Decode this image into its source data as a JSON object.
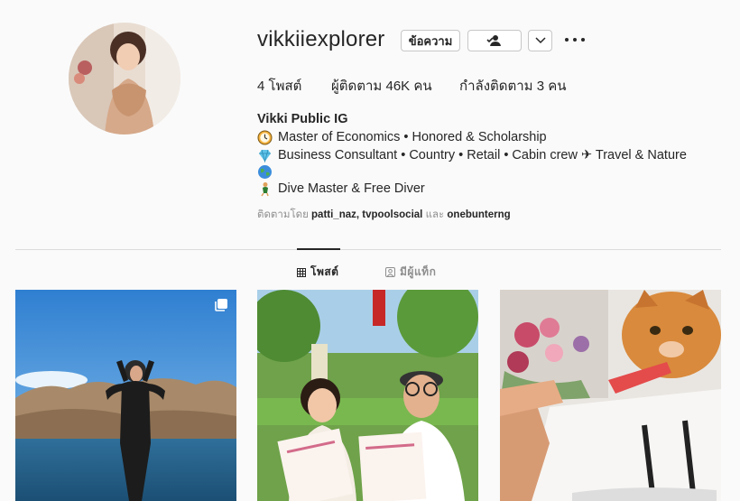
{
  "profile": {
    "username": "vikkiiexplorer",
    "message_button": "ข้อความ",
    "stats": {
      "posts": "4 โพสต์",
      "followers": "ผู้ติดตาม 46K คน",
      "following": "กำลังติดตาม 3 คน"
    },
    "full_name": "Vikki Public IG",
    "bio": [
      {
        "icon": "clock-emoji",
        "text": "Master of Economics • Honored & Scholarship"
      },
      {
        "icon": "gem-emoji",
        "text": "Business Consultant • Country • Retail • Cabin crew ✈ Travel & Nature"
      },
      {
        "icon": "globe-emoji",
        "text": ""
      },
      {
        "icon": "diver-emoji",
        "text": "Dive Master & Free Diver"
      }
    ],
    "followed_by": {
      "prefix": "ติดตามโดย",
      "names": "patti_naz, tvpoolsocial",
      "and": "และ",
      "last": "onebunterng"
    }
  },
  "tabs": {
    "posts": "โพสต์",
    "tagged": "มีผู้แท็ก"
  },
  "colors": {
    "text": "#262626",
    "muted": "#8e8e8e",
    "border": "#dbdbdb",
    "background": "#fafafa"
  }
}
